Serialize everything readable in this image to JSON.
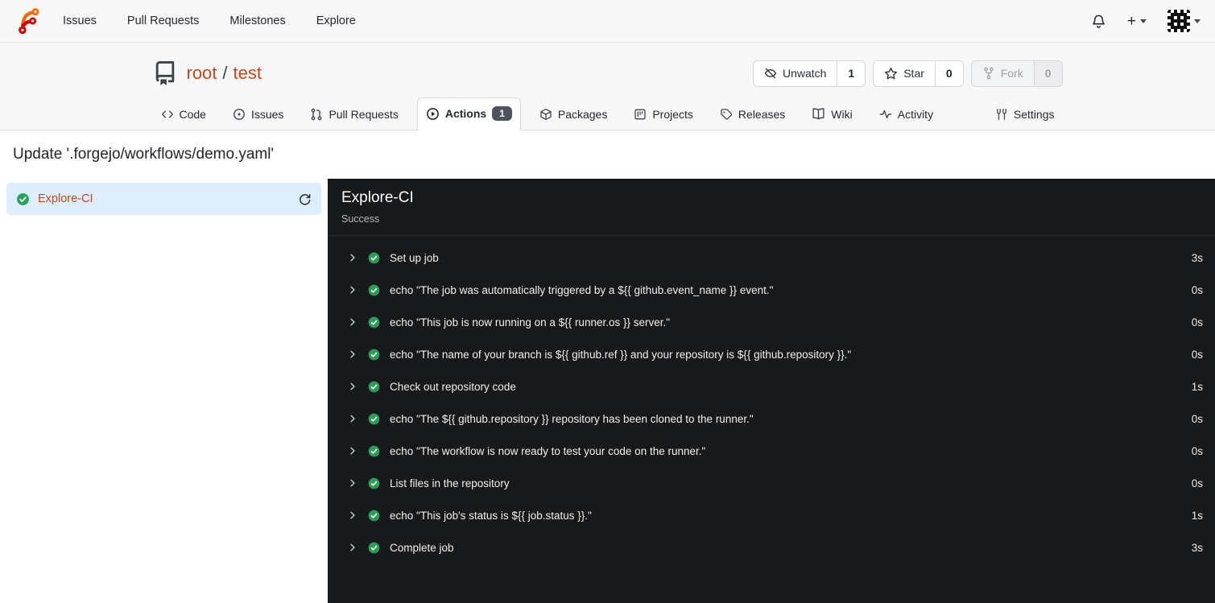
{
  "colors": {
    "brand_orange": "#ff6600",
    "brand_red": "#d40000",
    "link_orange": "#c7461d",
    "success_green": "#28a25c",
    "active_job_bg": "#dceefc",
    "panel_bg": "#18191b",
    "actions_badge_bg": "#4e545e"
  },
  "icons": {
    "plus": "+"
  },
  "topnav": {
    "links": [
      "Issues",
      "Pull Requests",
      "Milestones",
      "Explore"
    ]
  },
  "repo": {
    "owner": "root",
    "separator": "/",
    "name": "test",
    "watch": {
      "label": "Unwatch",
      "count": "1"
    },
    "star": {
      "label": "Star",
      "count": "0"
    },
    "fork": {
      "label": "Fork",
      "count": "0"
    }
  },
  "tabs": {
    "code": "Code",
    "issues": "Issues",
    "pulls": "Pull Requests",
    "actions": "Actions",
    "actions_badge": "1",
    "packages": "Packages",
    "projects": "Projects",
    "releases": "Releases",
    "wiki": "Wiki",
    "activity": "Activity",
    "settings": "Settings"
  },
  "run": {
    "title": "Update '.forgejo/workflows/demo.yaml'",
    "job_name": "Explore-CI",
    "job_status": "Success"
  },
  "steps": [
    {
      "label": "Set up job",
      "duration": "3s"
    },
    {
      "label": "echo \"The job was automatically triggered by a ${{ github.event_name }} event.\"",
      "duration": "0s"
    },
    {
      "label": "echo \"This job is now running on a ${{ runner.os }} server.\"",
      "duration": "0s"
    },
    {
      "label": "echo \"The name of your branch is ${{ github.ref }} and your repository is ${{ github.repository }}.\"",
      "duration": "0s"
    },
    {
      "label": "Check out repository code",
      "duration": "1s"
    },
    {
      "label": "echo \"The ${{ github.repository }} repository has been cloned to the runner.\"",
      "duration": "0s"
    },
    {
      "label": "echo \"The workflow is now ready to test your code on the runner.\"",
      "duration": "0s"
    },
    {
      "label": "List files in the repository",
      "duration": "0s"
    },
    {
      "label": "echo \"This job's status is ${{ job.status }}.\"",
      "duration": "1s"
    },
    {
      "label": "Complete job",
      "duration": "3s"
    }
  ]
}
